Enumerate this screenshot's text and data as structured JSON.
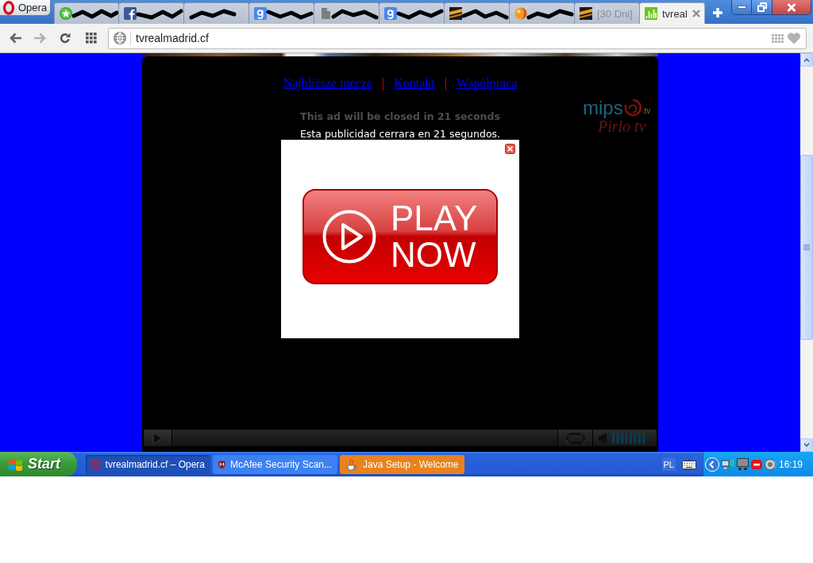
{
  "browser": {
    "menu_button": "Opera",
    "tabs": [
      {
        "selected": false,
        "redacted": true
      },
      {
        "selected": false,
        "redacted": true
      },
      {
        "selected": false,
        "redacted": true
      },
      {
        "selected": false,
        "redacted": true
      },
      {
        "selected": false,
        "redacted": true
      },
      {
        "selected": false,
        "redacted": true
      },
      {
        "selected": false,
        "redacted": true
      },
      {
        "selected": false,
        "redacted": true
      },
      {
        "label": "[30 Dni]",
        "selected": false,
        "redacted": false
      },
      {
        "label": "tvreal",
        "selected": true,
        "redacted": false
      }
    ],
    "address": "tvrealmadrid.cf"
  },
  "page": {
    "nav": [
      {
        "kind": "link",
        "text": "Najbliższe mecze"
      },
      {
        "kind": "separator",
        "text": "|"
      },
      {
        "kind": "link",
        "text": "Kontakt"
      },
      {
        "kind": "separator",
        "text": "|"
      },
      {
        "kind": "link",
        "text": "Współpraca"
      }
    ],
    "logo": {
      "name": "mips",
      "suffix": ".tv",
      "tagline": "Pirlo tv"
    },
    "ad_countdown": "This ad will be closed in 21 seconds",
    "ad_countdown_es": "Esta publicidad cerrara en 21 segundos.",
    "ad": {
      "button_label": "PLAY NOW"
    }
  },
  "taskbar": {
    "start_label": "Start",
    "tasks": [
      {
        "label": "tvrealmadrid.cf – Opera",
        "selected": true,
        "flashing": false
      },
      {
        "label": "McAfee Security Scan...",
        "selected": false,
        "flashing": false
      },
      {
        "label": "Java Setup - Welcome",
        "selected": false,
        "flashing": true
      }
    ],
    "language": "PL",
    "clock": "16:19"
  }
}
